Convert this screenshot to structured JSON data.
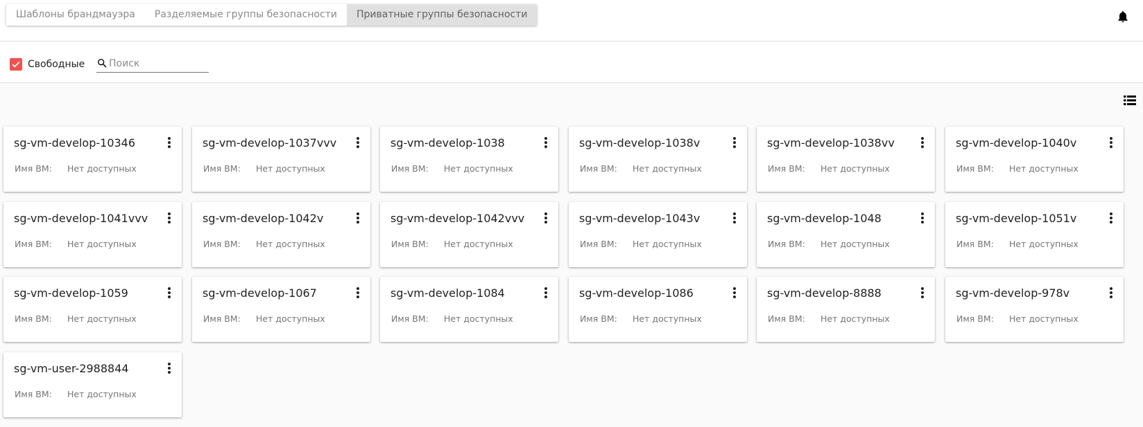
{
  "tabs": [
    {
      "label": "Шаблоны брандмауэра",
      "active": false
    },
    {
      "label": "Разделяемые группы безопасности",
      "active": false
    },
    {
      "label": "Приватные группы безопасности",
      "active": true
    }
  ],
  "header": {
    "bell_icon": "bell-icon"
  },
  "filters": {
    "free_checkbox": {
      "label": "Свободные",
      "checked": true
    },
    "search": {
      "placeholder": "Поиск",
      "value": ""
    }
  },
  "view_toggle_icon": "list-view-icon",
  "colors": {
    "accent": "#ef5350"
  },
  "cards": [
    {
      "title": "sg-vm-develop-10346",
      "vm_label": "Имя ВМ:",
      "vm_value": "Нет доступных"
    },
    {
      "title": "sg-vm-develop-1037vvv",
      "vm_label": "Имя ВМ:",
      "vm_value": "Нет доступных"
    },
    {
      "title": "sg-vm-develop-1038",
      "vm_label": "Имя ВМ:",
      "vm_value": "Нет доступных"
    },
    {
      "title": "sg-vm-develop-1038v",
      "vm_label": "Имя ВМ:",
      "vm_value": "Нет доступных"
    },
    {
      "title": "sg-vm-develop-1038vv",
      "vm_label": "Имя ВМ:",
      "vm_value": "Нет доступных"
    },
    {
      "title": "sg-vm-develop-1040v",
      "vm_label": "Имя ВМ:",
      "vm_value": "Нет доступных"
    },
    {
      "title": "sg-vm-develop-1041vvv",
      "vm_label": "Имя ВМ:",
      "vm_value": "Нет доступных"
    },
    {
      "title": "sg-vm-develop-1042v",
      "vm_label": "Имя ВМ:",
      "vm_value": "Нет доступных"
    },
    {
      "title": "sg-vm-develop-1042vvv",
      "vm_label": "Имя ВМ:",
      "vm_value": "Нет доступных"
    },
    {
      "title": "sg-vm-develop-1043v",
      "vm_label": "Имя ВМ:",
      "vm_value": "Нет доступных"
    },
    {
      "title": "sg-vm-develop-1048",
      "vm_label": "Имя ВМ:",
      "vm_value": "Нет доступных"
    },
    {
      "title": "sg-vm-develop-1051v",
      "vm_label": "Имя ВМ:",
      "vm_value": "Нет доступных"
    },
    {
      "title": "sg-vm-develop-1059",
      "vm_label": "Имя ВМ:",
      "vm_value": "Нет доступных"
    },
    {
      "title": "sg-vm-develop-1067",
      "vm_label": "Имя ВМ:",
      "vm_value": "Нет доступных"
    },
    {
      "title": "sg-vm-develop-1084",
      "vm_label": "Имя ВМ:",
      "vm_value": "Нет доступных"
    },
    {
      "title": "sg-vm-develop-1086",
      "vm_label": "Имя ВМ:",
      "vm_value": "Нет доступных"
    },
    {
      "title": "sg-vm-develop-8888",
      "vm_label": "Имя ВМ:",
      "vm_value": "Нет доступных"
    },
    {
      "title": "sg-vm-develop-978v",
      "vm_label": "Имя ВМ:",
      "vm_value": "Нет доступных"
    },
    {
      "title": "sg-vm-user-2988844",
      "vm_label": "Имя ВМ:",
      "vm_value": "Нет доступных"
    }
  ]
}
